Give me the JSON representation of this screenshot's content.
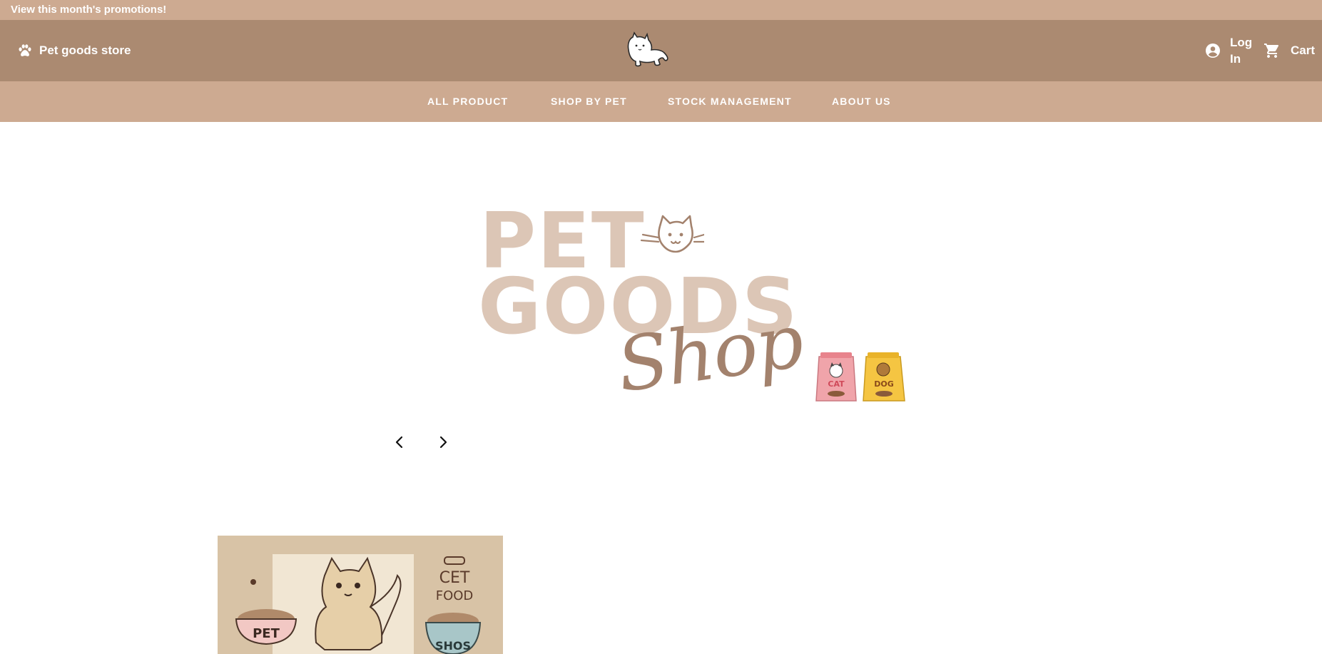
{
  "promo": {
    "text": "View this month's promotions!"
  },
  "header": {
    "brand_icon": "paw-icon",
    "brand_name": "Pet goods store",
    "logo_icon": "cat-logo-icon",
    "login_icon": "account-circle-icon",
    "login_label": "Log In",
    "cart_icon": "shopping-cart-icon",
    "cart_label": "Cart"
  },
  "nav": {
    "items": [
      {
        "label": "ALL PRODUCT"
      },
      {
        "label": "SHOP BY PET"
      },
      {
        "label": "STOCK MANAGEMENT"
      },
      {
        "label": "ABOUT US"
      }
    ]
  },
  "hero": {
    "line1": "PET",
    "line2": "GOODS",
    "script": "Shop",
    "bag_left_label": "CAT",
    "bag_right_label": "DOG"
  },
  "slider": {
    "prev_icon": "chevron-left-icon",
    "next_icon": "chevron-right-icon"
  },
  "product_card": {
    "bowl_left_label": "PET",
    "sign_line1": "CET",
    "sign_line2": "FOOD",
    "bowl_right_label": "SHOS"
  },
  "colors": {
    "promo_bar": "#cdaa91",
    "header": "#ab8a71",
    "nav": "#cdaa91",
    "hero_text": "#dcc6b6",
    "hero_script": "#a3826d"
  }
}
